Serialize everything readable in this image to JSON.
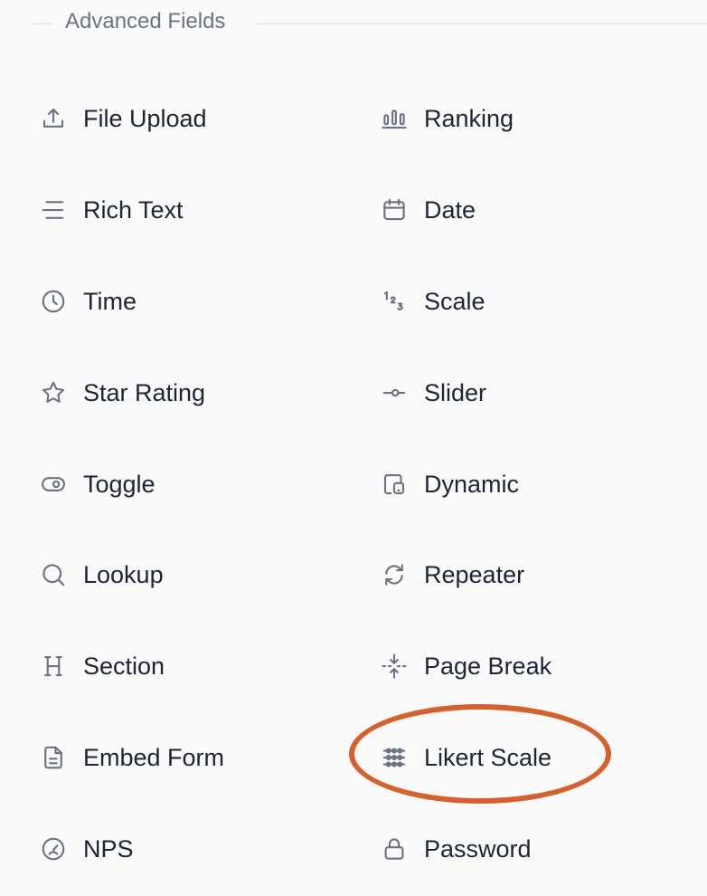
{
  "section": {
    "title": "Advanced Fields"
  },
  "fields": [
    {
      "label": "File Upload",
      "icon": "upload-icon"
    },
    {
      "label": "Ranking",
      "icon": "ranking-icon"
    },
    {
      "label": "Rich Text",
      "icon": "rich-text-icon"
    },
    {
      "label": "Date",
      "icon": "calendar-icon"
    },
    {
      "label": "Time",
      "icon": "clock-icon"
    },
    {
      "label": "Scale",
      "icon": "scale-icon"
    },
    {
      "label": "Star Rating",
      "icon": "star-icon"
    },
    {
      "label": "Slider",
      "icon": "slider-icon"
    },
    {
      "label": "Toggle",
      "icon": "toggle-icon"
    },
    {
      "label": "Dynamic",
      "icon": "dynamic-icon"
    },
    {
      "label": "Lookup",
      "icon": "search-icon"
    },
    {
      "label": "Repeater",
      "icon": "repeat-icon"
    },
    {
      "label": "Section",
      "icon": "heading-icon"
    },
    {
      "label": "Page Break",
      "icon": "page-break-icon"
    },
    {
      "label": "Embed Form",
      "icon": "document-icon"
    },
    {
      "label": "Likert Scale",
      "icon": "likert-icon"
    },
    {
      "label": "NPS",
      "icon": "gauge-icon"
    },
    {
      "label": "Password",
      "icon": "lock-icon"
    }
  ],
  "highlight": {
    "target": "Likert Scale",
    "color": "#d5612f"
  }
}
